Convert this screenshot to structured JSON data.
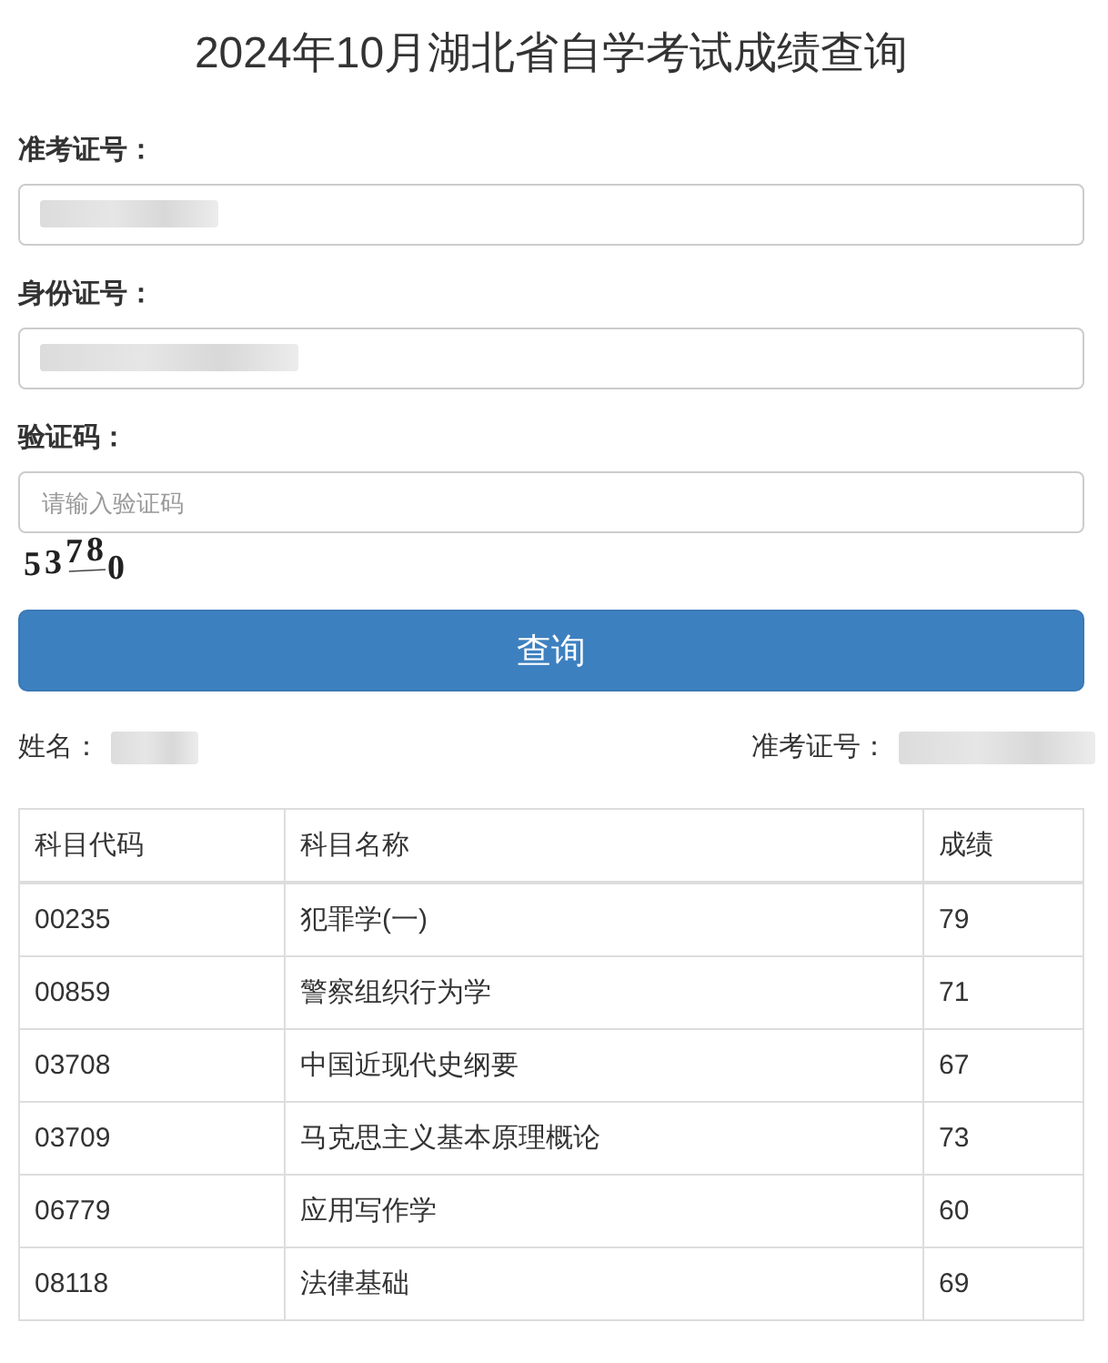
{
  "title": "2024年10月湖北省自学考试成绩查询",
  "form": {
    "fields": [
      {
        "label": "准考证号：",
        "value_redacted": true
      },
      {
        "label": "身份证号：",
        "value_redacted": true
      },
      {
        "label": "验证码：",
        "placeholder": "请输入验证码",
        "value_redacted": false
      }
    ],
    "captcha": {
      "characters": "53780"
    },
    "submit_button": "查询"
  },
  "result": {
    "info": [
      {
        "label": "姓名：",
        "redacted": true
      },
      {
        "label": "准考证号：",
        "redacted": true
      }
    ],
    "table": {
      "columns": [
        "科目代码",
        "科目名称",
        "成绩"
      ],
      "rows": [
        [
          "00235",
          "犯罪学(一)",
          "79"
        ],
        [
          "00859",
          "警察组织行为学",
          "71"
        ],
        [
          "03708",
          "中国近现代史纲要",
          "67"
        ],
        [
          "03709",
          "马克思主义基本原理概论",
          "73"
        ],
        [
          "06779",
          "应用写作学",
          "60"
        ],
        [
          "08118",
          "法律基础",
          "69"
        ]
      ]
    }
  }
}
